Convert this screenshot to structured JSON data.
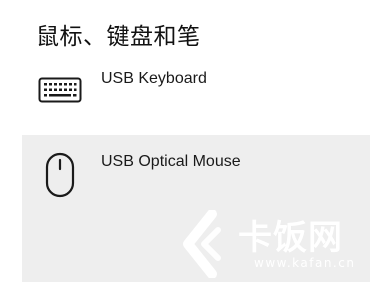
{
  "section": {
    "title": "鼠标、键盘和笔"
  },
  "devices": [
    {
      "name": "USB Keyboard",
      "icon": "keyboard-icon"
    },
    {
      "name": "USB Optical Mouse",
      "icon": "mouse-icon"
    }
  ],
  "watermark": {
    "brand": "卡饭网",
    "url": "www.kafan.cn"
  },
  "colors": {
    "background": "#ffffff",
    "selected_row": "#eeeeee",
    "text": "#1a1a1a",
    "watermark": "#ffffff"
  }
}
